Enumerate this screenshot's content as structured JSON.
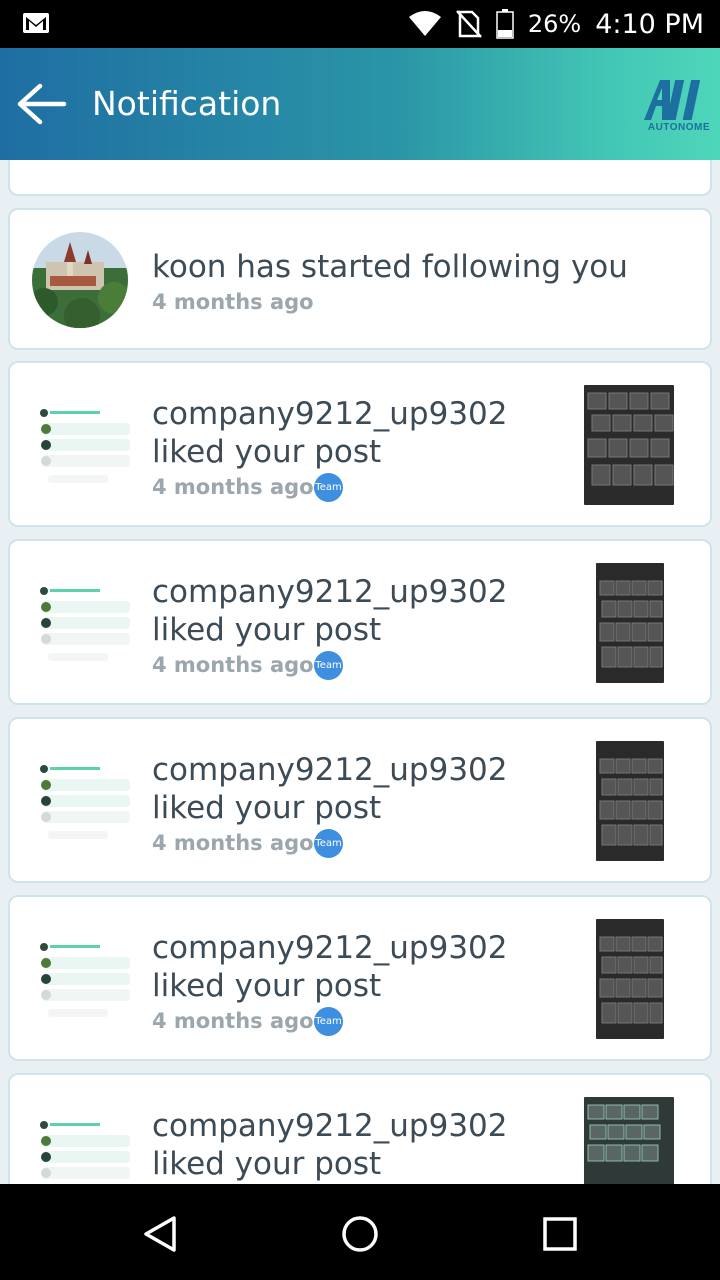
{
  "status_bar": {
    "battery": "26%",
    "time": "4:10 PM",
    "icons": [
      "gmail-icon",
      "wifi-icon",
      "no-sim-icon",
      "battery-icon"
    ]
  },
  "header": {
    "title": "Notification",
    "logo_text": "AUTONOME",
    "colors": {
      "gradient_start": "#1f6ea3",
      "gradient_end": "#4ed6ba"
    }
  },
  "notifications": [
    {
      "type": "follow",
      "message": "koon has started following you",
      "time": "4 months ago",
      "badge": ""
    },
    {
      "type": "like",
      "line1": "company9212_up9302",
      "line2": "liked your post",
      "time": "4 months ago",
      "badge": "Team"
    },
    {
      "type": "like",
      "line1": "company9212_up9302",
      "line2": "liked your post",
      "time": "4 months ago",
      "badge": "Team"
    },
    {
      "type": "like",
      "line1": "company9212_up9302",
      "line2": "liked your post",
      "time": "4 months ago",
      "badge": "Team"
    },
    {
      "type": "like",
      "line1": "company9212_up9302",
      "line2": "liked your post",
      "time": "4 months ago",
      "badge": "Team"
    },
    {
      "type": "like",
      "line1": "company9212_up9302",
      "line2": "liked your post",
      "time": "",
      "badge": ""
    }
  ],
  "nav": {
    "icons": [
      "back-nav-icon",
      "home-nav-icon",
      "recents-nav-icon"
    ]
  }
}
